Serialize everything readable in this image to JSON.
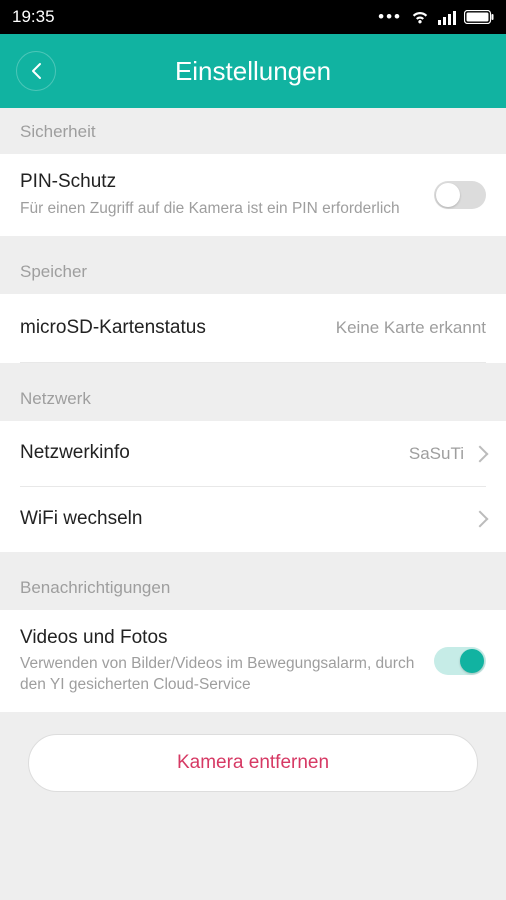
{
  "status": {
    "time": "19:35"
  },
  "header": {
    "title": "Einstellungen"
  },
  "sections": {
    "security": {
      "label": "Sicherheit",
      "pin": {
        "title": "PIN-Schutz",
        "subtitle": "Für einen Zugriff auf die Kamera ist ein PIN erforderlich",
        "enabled": false
      }
    },
    "storage": {
      "label": "Speicher",
      "sdcard": {
        "title": "microSD-Kartenstatus",
        "value": "Keine Karte erkannt"
      }
    },
    "network": {
      "label": "Netzwerk",
      "info": {
        "title": "Netzwerkinfo",
        "value": "SaSuTi"
      },
      "changeWifi": {
        "title": "WiFi wechseln"
      }
    },
    "notifications": {
      "label": "Benachrichtigungen",
      "media": {
        "title": "Videos und Fotos",
        "subtitle": "Verwenden von Bilder/Videos im Bewegungsalarm, durch den YI gesicherten Cloud-Service",
        "enabled": true
      }
    }
  },
  "footer": {
    "remove": "Kamera entfernen"
  }
}
